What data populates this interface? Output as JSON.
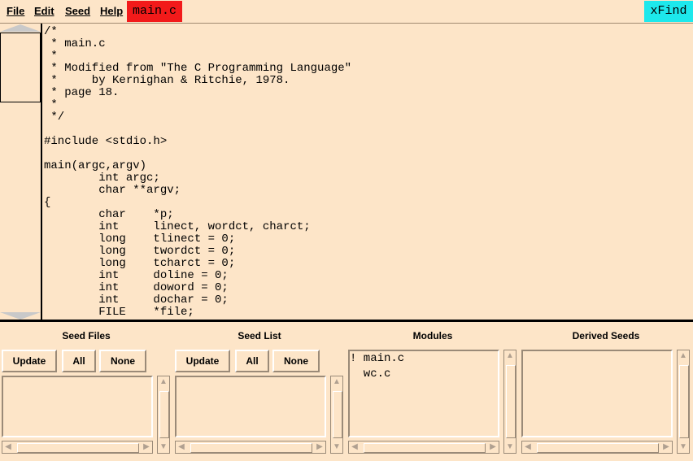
{
  "menubar": {
    "items": [
      "File",
      "Edit",
      "Seed",
      "Help"
    ],
    "file_title": "main.c",
    "xfind_label": "xFind"
  },
  "editor": {
    "lines": [
      "/*",
      " * main.c",
      " *",
      " * Modified from \"The C Programming Language\"",
      " *     by Kernighan & Ritchie, 1978.",
      " * page 18.",
      " *",
      " */",
      "",
      "#include <stdio.h>",
      "",
      "main(argc,argv)",
      "        int argc;",
      "        char **argv;",
      "{",
      "        char    *p;",
      "        int     linect, wordct, charct;",
      "        long    tlinect = 0;",
      "        long    twordct = 0;",
      "        long    tcharct = 0;",
      "        int     doline = 0;",
      "        int     doword = 0;",
      "        int     dochar = 0;",
      "        FILE    *file;"
    ]
  },
  "panels": {
    "seed_files": {
      "title": "Seed Files",
      "buttons": [
        "Update",
        "All",
        "None"
      ]
    },
    "seed_list": {
      "title": "Seed List",
      "buttons": [
        "Update",
        "All",
        "None"
      ]
    },
    "modules": {
      "title": "Modules",
      "items": [
        "! main.c",
        "  wc.c"
      ]
    },
    "derived_seeds": {
      "title": "Derived Seeds"
    }
  },
  "icons": {
    "scroll_up": "triangle-up-icon",
    "scroll_down": "triangle-down-icon",
    "arrow_left": "arrow-left-icon",
    "arrow_right": "arrow-right-icon"
  },
  "colors": {
    "background": "#fde5c8",
    "file_tab": "#f21a1a",
    "xfind": "#1de8ec"
  }
}
